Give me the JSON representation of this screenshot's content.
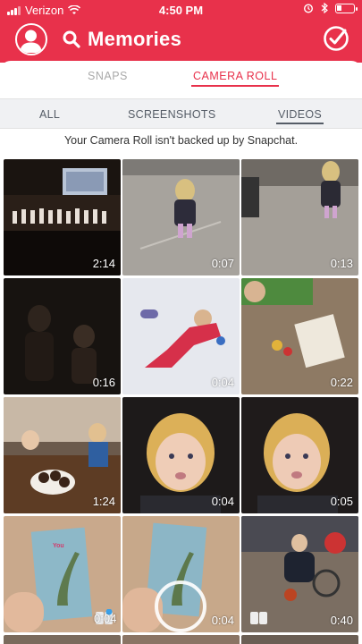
{
  "status_bar": {
    "carrier": "Verizon",
    "time": "4:50 PM"
  },
  "header": {
    "title": "Memories"
  },
  "tabs": {
    "snaps": "SNAPS",
    "camera_roll": "CAMERA ROLL"
  },
  "filters": {
    "all": "ALL",
    "screenshots": "SCREENSHOTS",
    "videos": "VIDEOS"
  },
  "notice": "Your Camera Roll isn't backed up by Snapchat.",
  "videos": [
    {
      "duration": "2:14"
    },
    {
      "duration": "0:07"
    },
    {
      "duration": "0:13"
    },
    {
      "duration": "0:16"
    },
    {
      "duration": "0:04"
    },
    {
      "duration": "0:22"
    },
    {
      "duration": "1:24"
    },
    {
      "duration": "0:04"
    },
    {
      "duration": "0:05"
    },
    {
      "duration": "0:04"
    },
    {
      "duration": "0:04"
    },
    {
      "duration": "0:40"
    }
  ],
  "colors": {
    "brand": "#e8314b"
  }
}
